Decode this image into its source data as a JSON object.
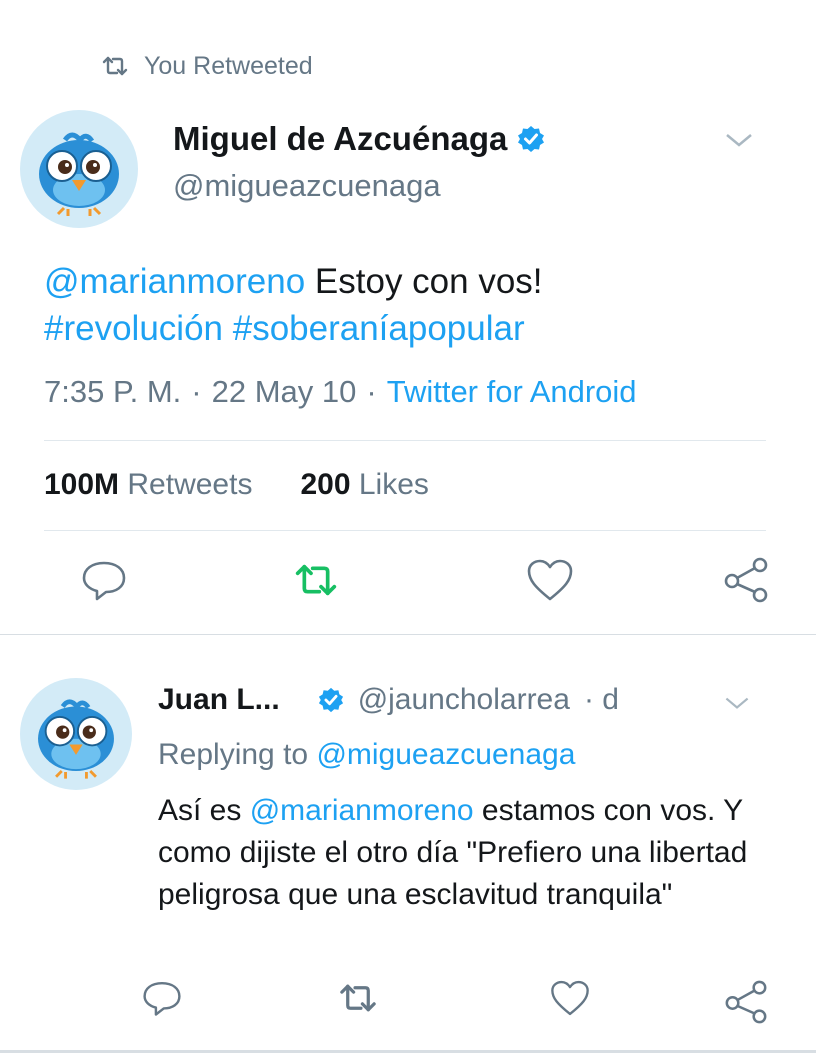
{
  "retweet_header": {
    "label": "You Retweeted"
  },
  "tweet": {
    "author_name": "Miguel de Azcuénaga",
    "author_handle": "@migueazcuenaga",
    "mention": "@marianmoreno",
    "text_rest": " Estoy con vos!",
    "hashtag1": "#revolución",
    "hashtag2": "#soberaníapopular",
    "time": "7:35 P. M.",
    "date": "22 May 10",
    "source": "Twitter for Android",
    "sep": "·",
    "retweets_count": "100M",
    "retweets_label": "Retweets",
    "likes_count": "200",
    "likes_label": "Likes"
  },
  "reply": {
    "author_name": "Juan L...",
    "author_handle": "@jauncholarrea",
    "age": "· d",
    "replying_prefix": "Replying to ",
    "replying_handle": "@migueazcuenaga",
    "text_part1": "Así es ",
    "mention": "@marianmoreno",
    "text_part2": " estamos con vos. Y como dijiste el otro día \"Prefiero una libertad peligrosa que una esclavitud tranquila\""
  },
  "icons": {
    "retweet_header": "retweet-icon",
    "verified": "verified-badge-icon",
    "caret": "chevron-down-icon",
    "reply": "reply-icon",
    "retweet": "retweet-icon",
    "like": "heart-icon",
    "share": "share-icon"
  },
  "colors": {
    "link": "#1da1f2",
    "secondary": "#657786",
    "retweet_active": "#17bf63",
    "divider": "#e1e8ed"
  }
}
